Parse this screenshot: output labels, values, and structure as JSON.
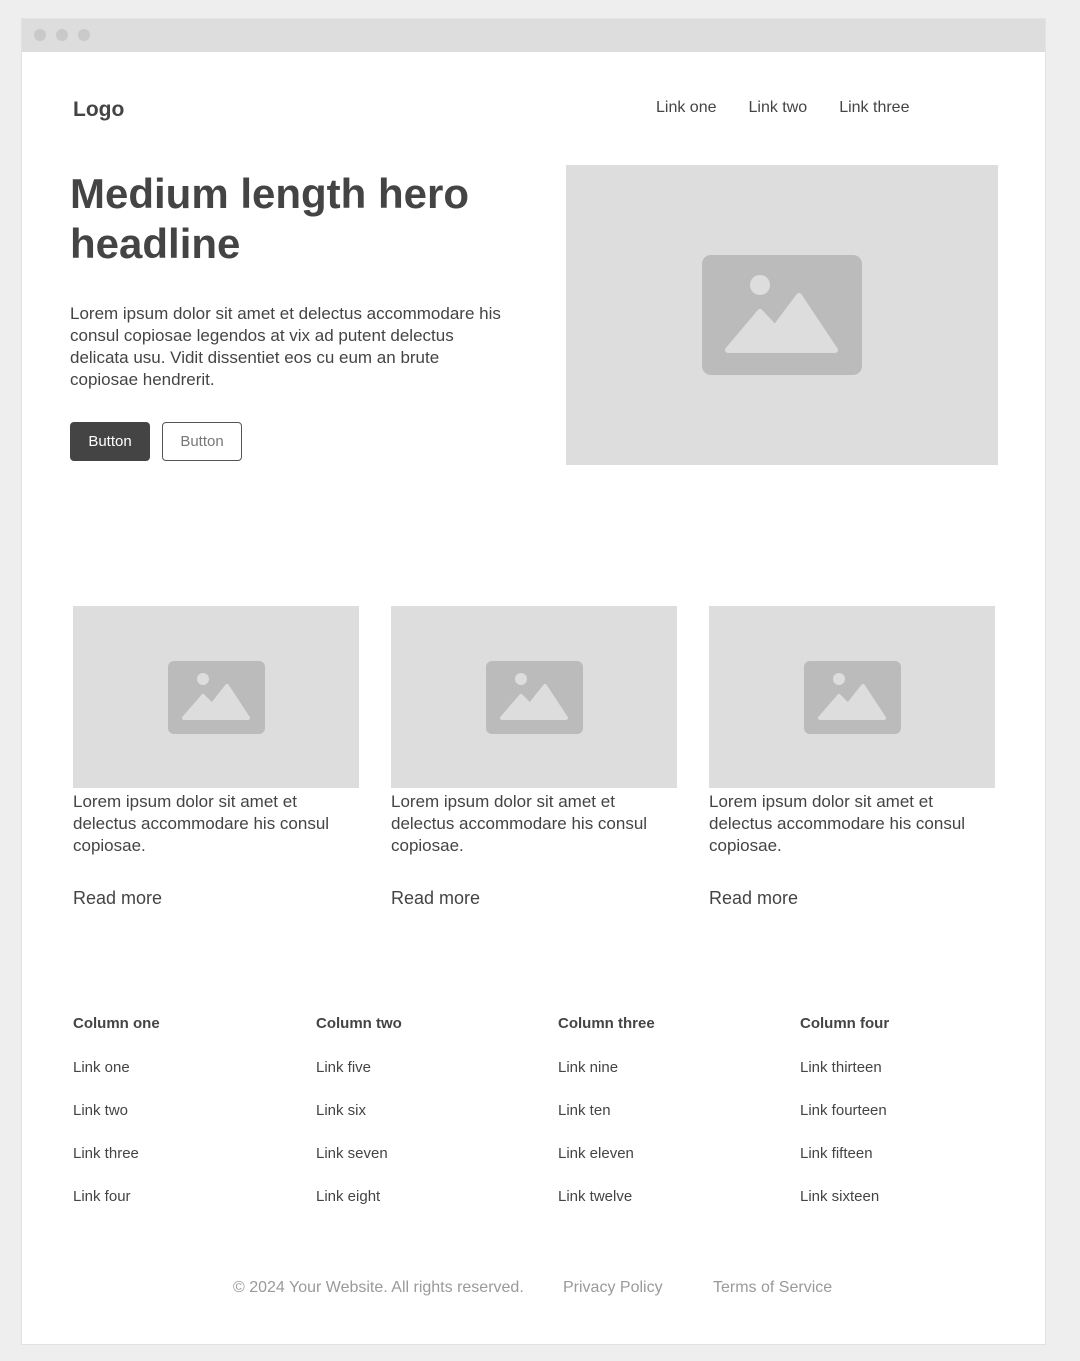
{
  "logo": "Logo",
  "nav": {
    "links": [
      "Link one",
      "Link two",
      "Link three"
    ]
  },
  "hero": {
    "headline": "Medium length hero headline",
    "body": "Lorem ipsum dolor sit amet et delectus accommodare his consul copiosae legendos at vix ad putent delectus delicata usu. Vidit dissentiet eos cu eum an brute copiosae hendrerit.",
    "primary_button": "Button",
    "secondary_button": "Button",
    "image_icon": "image-placeholder-icon"
  },
  "cards": [
    {
      "text": "Lorem ipsum dolor sit amet et delectus accommodare his consul copiosae.",
      "link": "Read more",
      "image_icon": "image-placeholder-icon"
    },
    {
      "text": "Lorem ipsum dolor sit amet et delectus accommodare his consul copiosae.",
      "link": "Read more",
      "image_icon": "image-placeholder-icon"
    },
    {
      "text": "Lorem ipsum dolor sit amet et delectus accommodare his consul copiosae.",
      "link": "Read more",
      "image_icon": "image-placeholder-icon"
    }
  ],
  "footer": {
    "columns": [
      {
        "title": "Column one",
        "links": [
          "Link one",
          "Link two",
          "Link three",
          "Link four"
        ]
      },
      {
        "title": "Column two",
        "links": [
          "Link five",
          "Link six",
          "Link seven",
          "Link eight"
        ]
      },
      {
        "title": "Column three",
        "links": [
          "Link nine",
          "Link ten",
          "Link eleven",
          "Link twelve"
        ]
      },
      {
        "title": "Column four",
        "links": [
          "Link thirteen",
          "Link fourteen",
          "Link fifteen",
          "Link sixteen"
        ]
      }
    ],
    "copyright": "© 2024 Your Website. All rights reserved.",
    "privacy": "Privacy Policy",
    "terms": "Terms of Service"
  },
  "colors": {
    "primary": "#444444",
    "placeholder": "#dddddd",
    "placeholder_icon": "#bbbbbb",
    "muted": "#9a9a9a"
  }
}
